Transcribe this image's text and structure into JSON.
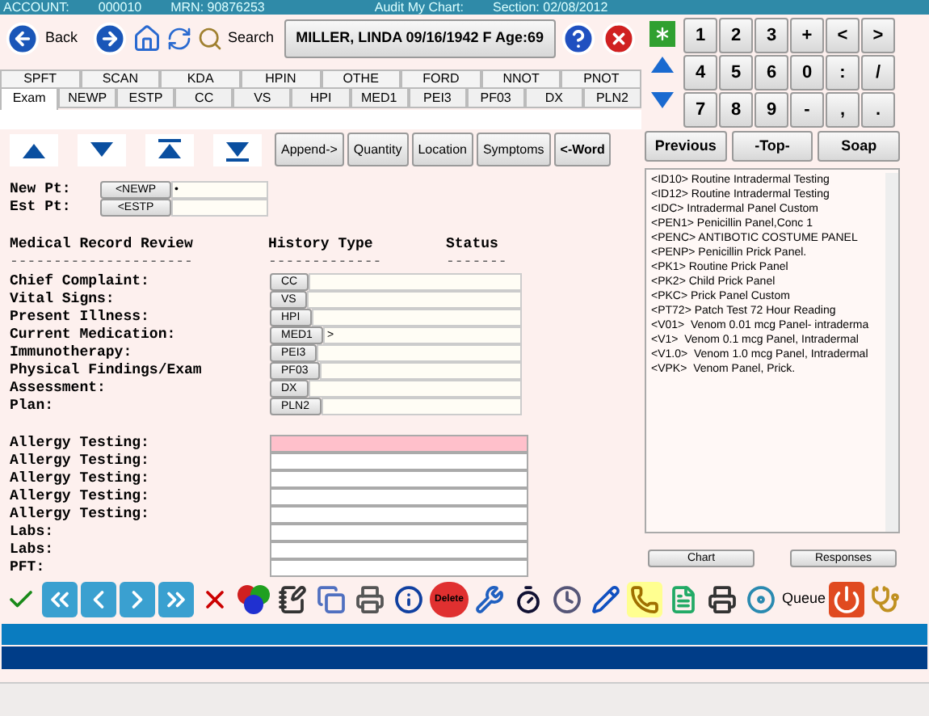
{
  "title_bar": {
    "account_label": "ACCOUNT:",
    "account": "000010",
    "mrn": "MRN: 90876253",
    "audit": "Audit My Chart:",
    "section": "Section: 02/08/2012"
  },
  "nav": {
    "back": "Back",
    "search": "Search",
    "patient": "MILLER, LINDA 09/16/1942 F Age:69"
  },
  "keypad": [
    "1",
    "2",
    "3",
    "+",
    "<",
    ">",
    "4",
    "5",
    "6",
    "0",
    ":",
    "/",
    "7",
    "8",
    "9",
    "-",
    ",",
    "."
  ],
  "tabs_back": [
    "SPFT",
    "SCAN",
    "KDA",
    "HPIN",
    "OTHE",
    "FORD",
    "NNOT",
    "PNOT"
  ],
  "tabs_front": [
    {
      "label": "Exam",
      "selected": true
    },
    {
      "label": "NEWP",
      "selected": false
    },
    {
      "label": "ESTP",
      "selected": false
    },
    {
      "label": "CC",
      "selected": false
    },
    {
      "label": "VS",
      "selected": false
    },
    {
      "label": "HPI",
      "selected": false
    },
    {
      "label": "MED1",
      "selected": false
    },
    {
      "label": "PEI3",
      "selected": false
    },
    {
      "label": "PF03",
      "selected": false
    },
    {
      "label": "DX",
      "selected": false
    },
    {
      "label": "PLN2",
      "selected": false
    }
  ],
  "edit_buttons": [
    {
      "label": "Append->",
      "bold": false
    },
    {
      "label": "Quantity",
      "bold": false
    },
    {
      "label": "Location",
      "bold": false
    },
    {
      "label": "Symptoms",
      "bold": false
    },
    {
      "label": "<-Word",
      "bold": true
    }
  ],
  "page_buttons": [
    "Previous",
    "-Top-",
    "Soap"
  ],
  "patient_type": [
    {
      "label": "New Pt:",
      "button": "<NEWP",
      "value": "•"
    },
    {
      "label": "Est Pt:",
      "button": "<ESTP"
    }
  ],
  "review_headers": {
    "title": "Medical Record Review",
    "title_rule": "---------------------",
    "history": "History Type",
    "history_rule": "-------------",
    "status": "Status",
    "status_rule": "-------"
  },
  "history_rows": [
    {
      "label": "Chief Complaint:",
      "button": "CC",
      "value": ""
    },
    {
      "label": "Vital Signs:",
      "button": "VS",
      "value": ""
    },
    {
      "label": "Present Illness:",
      "button": "HPI",
      "value": ""
    },
    {
      "label": "Current Medication:",
      "button": "MED1",
      "value": ">"
    },
    {
      "label": "Immunotherapy:",
      "button": "PEI3",
      "value": ""
    },
    {
      "label": "Physical Findings/Exam",
      "button": "PF03",
      "value": ""
    },
    {
      "label": "Assessment:",
      "button": "DX",
      "value": ""
    },
    {
      "label": "Plan:",
      "button": "PLN2",
      "value": ""
    }
  ],
  "test_rows": [
    {
      "label": "Allergy Testing:",
      "highlighted": true
    },
    {
      "label": "Allergy Testing:",
      "highlighted": false
    },
    {
      "label": "Allergy Testing:",
      "highlighted": false
    },
    {
      "label": "Allergy Testing:",
      "highlighted": false
    },
    {
      "label": "Allergy Testing:",
      "highlighted": false
    },
    {
      "label": "Labs:",
      "highlighted": false
    },
    {
      "label": "Labs:",
      "highlighted": false
    },
    {
      "label": "PFT:",
      "highlighted": false
    }
  ],
  "panel_list": [
    "<ID10> Routine Intradermal Testing",
    "<ID12> Routine Intradermal Testing",
    "<IDC> Intradermal Panel Custom",
    "<PEN1> Penicillin Panel,Conc 1",
    "<PENC> ANTIBOTIC COSTUME PANEL",
    "<PENP> Penicillin Prick Panel.",
    "<PK1> Routine Prick Panel",
    "<PK2> Child Prick Panel",
    "<PKC> Prick Panel Custom",
    "<PT72> Patch Test 72 Hour Reading",
    "<V01>  Venom 0.01 mcg Panel- intraderma",
    "<V1>  Venom 0.1 mcg Panel, Intradermal",
    "<V1.0>  Venom 1.0 mcg Panel, Intradermal",
    "<VPK>  Venom Panel, Prick."
  ],
  "list_buttons": [
    "Chart",
    "Responses"
  ],
  "toolbar": {
    "delete_label": "Delete",
    "queue_label": "Queue"
  }
}
